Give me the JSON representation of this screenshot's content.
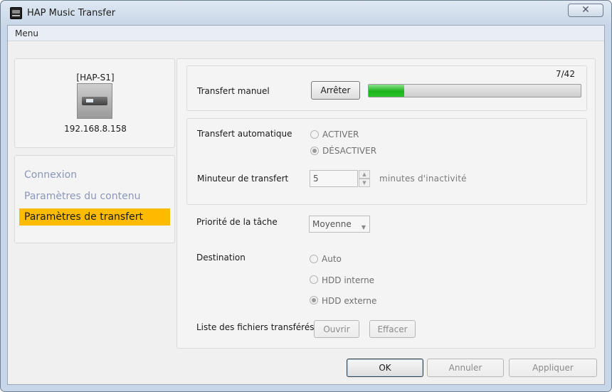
{
  "window": {
    "title": "HAP Music Transfer",
    "close_glyph": "✕"
  },
  "menu": {
    "label": "Menu"
  },
  "device": {
    "name": "[HAP-S1]",
    "ip": "192.168.8.158"
  },
  "nav": [
    {
      "label": "Connexion",
      "active": false
    },
    {
      "label": "Paramètres du contenu",
      "active": false
    },
    {
      "label": "Paramètres de transfert",
      "active": true
    }
  ],
  "manual": {
    "label": "Transfert manuel",
    "stop_button": "Arrêter",
    "progress_text": "7/42",
    "progress_fraction": 0.1667
  },
  "auto": {
    "label": "Transfert automatique",
    "options": [
      {
        "label": "ACTIVER",
        "checked": false
      },
      {
        "label": "DÉSACTIVER",
        "checked": true
      }
    ]
  },
  "timer": {
    "label": "Minuteur de transfert",
    "value": "5",
    "hint": "minutes d'inactivité",
    "up_glyph": "▲",
    "down_glyph": "▼"
  },
  "priority": {
    "label": "Priorité de la tâche",
    "value": "Moyenne",
    "arrow_glyph": "▼"
  },
  "destination": {
    "label": "Destination",
    "options": [
      {
        "label": "Auto",
        "checked": false
      },
      {
        "label": "HDD interne",
        "checked": false
      },
      {
        "label": "HDD externe",
        "checked": true
      }
    ]
  },
  "file_list": {
    "label": "Liste des fichiers transférés",
    "open_button": "Ouvrir",
    "clear_button": "Effacer"
  },
  "footer": {
    "ok": "OK",
    "cancel": "Annuler",
    "apply": "Appliquer"
  },
  "colors": {
    "accent": "#ffbb00",
    "progress": "#1bb31b"
  }
}
